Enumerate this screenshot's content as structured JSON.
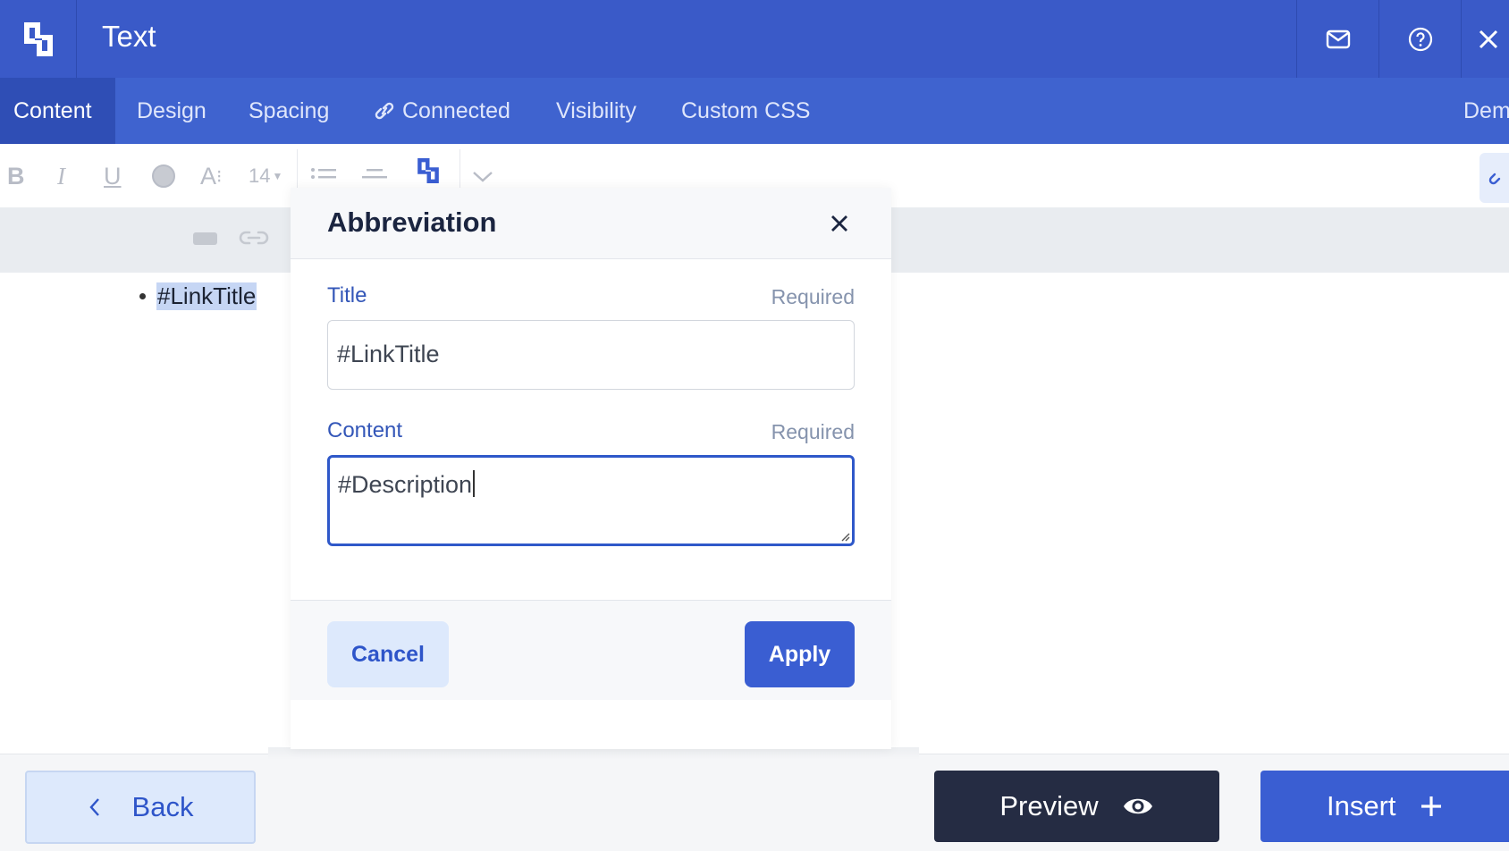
{
  "window": {
    "title": "Text",
    "icons": {
      "logo": "logo-icon",
      "mail": "mail-icon",
      "help": "help-icon",
      "close": "close-icon"
    }
  },
  "tabs": [
    {
      "label": "Content",
      "active": true
    },
    {
      "label": "Design"
    },
    {
      "label": "Spacing"
    },
    {
      "label": "Connected",
      "icon": "link-icon"
    },
    {
      "label": "Visibility"
    },
    {
      "label": "Custom CSS"
    },
    {
      "label": "Dem"
    }
  ],
  "toolbar": {
    "bold": "B",
    "italic": "I",
    "underline": "U",
    "font_size_prefix": "A",
    "font_size": "14"
  },
  "editor": {
    "bullet_text": "#LinkTitle"
  },
  "modal": {
    "title": "Abbreviation",
    "fields": [
      {
        "label": "Title",
        "required": "Required",
        "value": "#LinkTitle"
      },
      {
        "label": "Content",
        "required": "Required",
        "value": "#Description"
      }
    ],
    "cancel_label": "Cancel",
    "apply_label": "Apply"
  },
  "footer": {
    "back_label": "Back",
    "preview_label": "Preview",
    "insert_label": "Insert"
  },
  "colors": {
    "header": "#3a5ac8",
    "tabbar": "#3f63cf",
    "active_tab": "#2f4eb5",
    "primary": "#3a5ed2",
    "dark_button": "#252c43",
    "light_button": "#dde9fc"
  }
}
